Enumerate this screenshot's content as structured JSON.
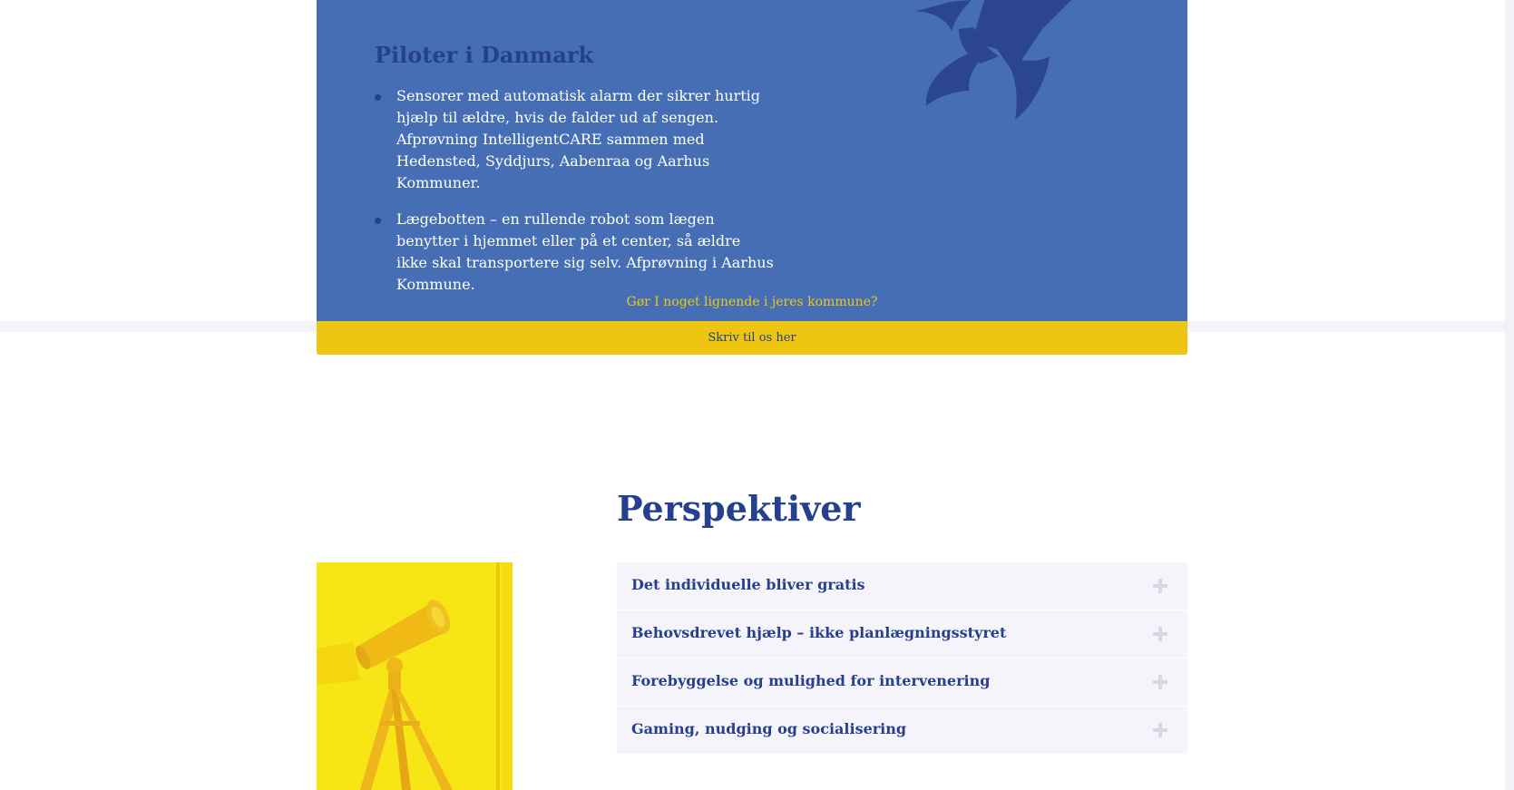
{
  "pilot": {
    "title": "Piloter i Danmark",
    "items": [
      {
        "text": "Sensorer med automatisk alarm der sikrer hurtig hjælp til ældre, hvis de falder ud af sengen. Afprøvning IntelligentCARE sammen med Hedensted, Syddjurs, Aabenraa og Aarhus Kommuner."
      },
      {
        "text": "Lægebotten – en rullende robot som lægen benytter i hjemmet eller på et center, så ældre ikke skal transportere sig selv. Afprøvning i Aarhus Kommune."
      }
    ],
    "question": "Gør I noget lignende i jeres kommune?",
    "cta_label": "Skriv til os her"
  },
  "perspektiver": {
    "title": "Perspektiver",
    "items": [
      {
        "label": "Det individuelle bliver gratis"
      },
      {
        "label": "Behovsdrevet hjælp – ikke planlægningsstyret"
      },
      {
        "label": "Forebyggelse og mulighed for intervenering"
      },
      {
        "label": "Gaming, nudging og socialisering"
      }
    ]
  },
  "icons": {
    "rocket": "rocket-icon",
    "accordion_toggle": "plus-icon"
  },
  "colors": {
    "brand_blue": "#456eb5",
    "navy": "#24408e",
    "yellow": "#eec611",
    "light_panel": "#f4f4fa"
  }
}
